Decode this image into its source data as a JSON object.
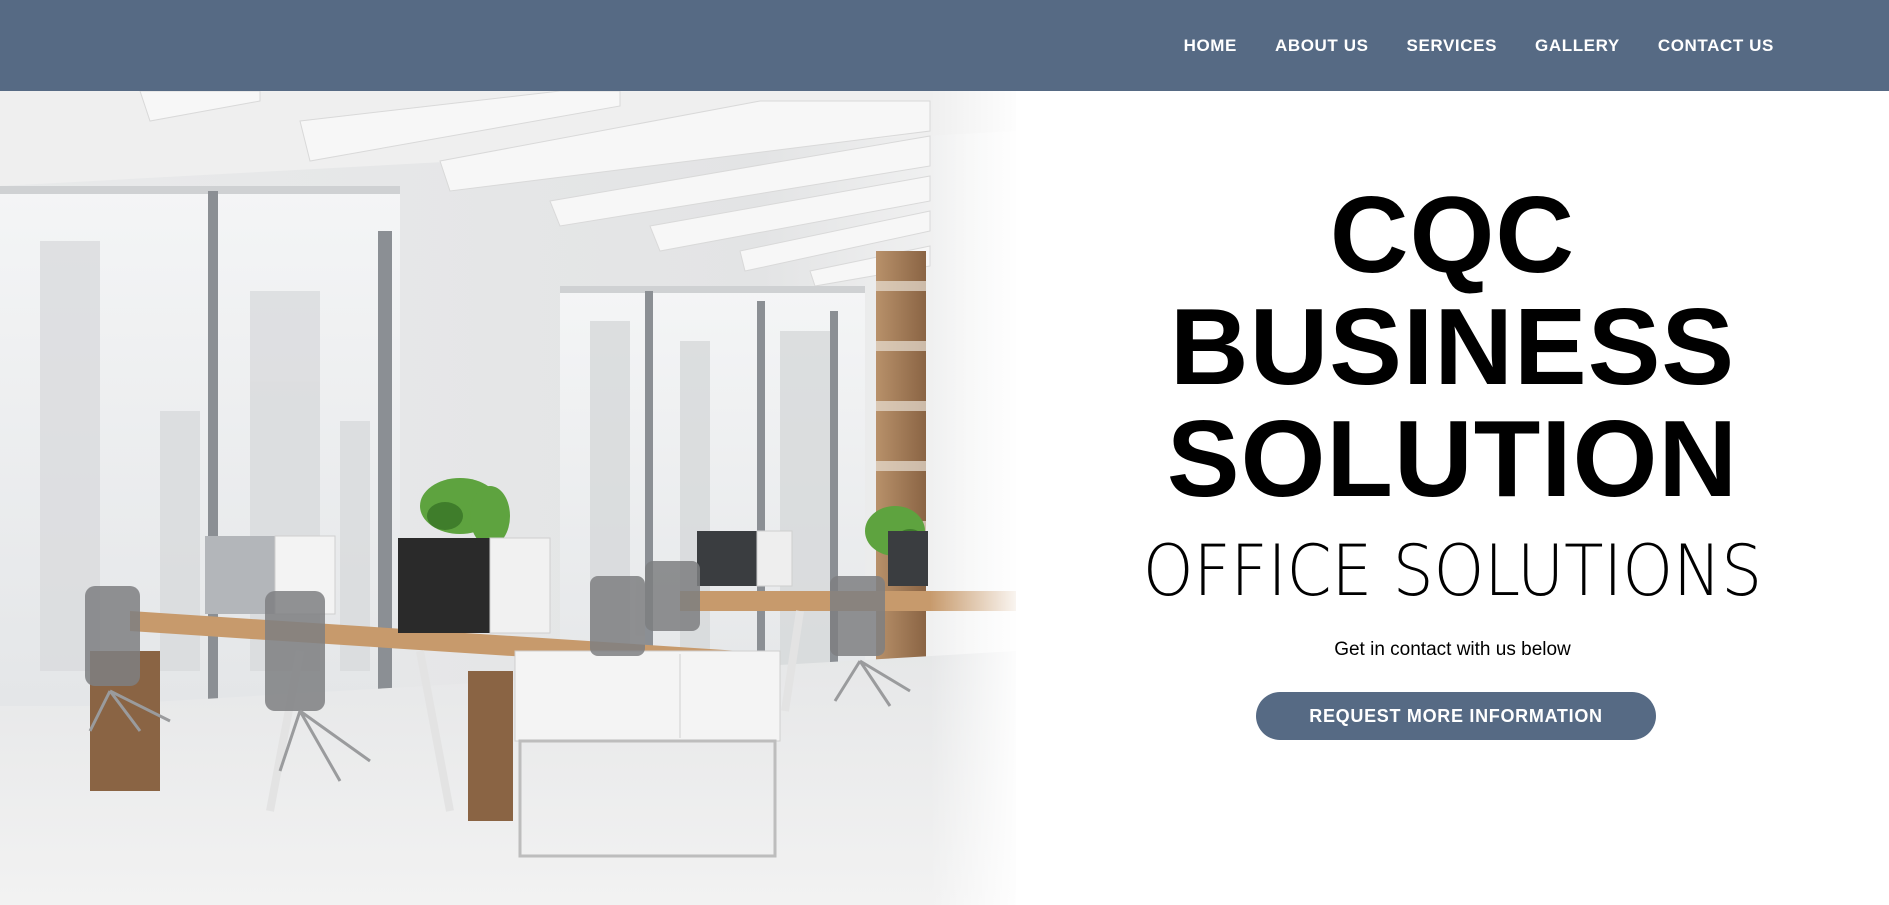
{
  "header": {
    "nav": [
      {
        "label": "HOME"
      },
      {
        "label": "ABOUT US"
      },
      {
        "label": "SERVICES"
      },
      {
        "label": "GALLERY"
      },
      {
        "label": "CONTACT US"
      }
    ]
  },
  "hero": {
    "image_alt": "office-interior-photo",
    "title_line1": "CQC",
    "title_line2": "BUSINESS",
    "title_line3": "SOLUTION",
    "subtitle": "OFFICE SOLUTIONS",
    "tagline": "Get in contact with us below",
    "cta_label": "REQUEST MORE INFORMATION"
  },
  "colors": {
    "brand": "#566a84",
    "text": "#000000",
    "background": "#ffffff"
  }
}
